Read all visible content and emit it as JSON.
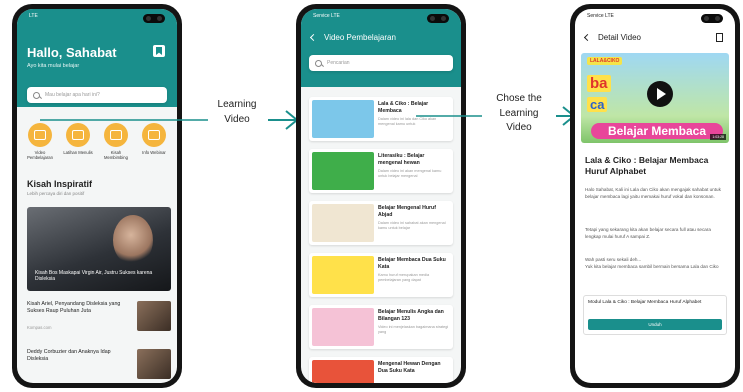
{
  "arrows": {
    "first_label": [
      "Learning",
      "Video"
    ],
    "second_label": [
      "Chose the",
      "Learning",
      "Video"
    ]
  },
  "home": {
    "status": "LTE",
    "greeting": "Hallo, Sahabat",
    "subtitle": "Ayo kita mulai belajar",
    "search_placeholder": "Mau belajar apa hari ini?",
    "categories": [
      {
        "label": "Video Pembelajaran",
        "icon": "play-icon"
      },
      {
        "label": "Latihan Menulis",
        "icon": "letter-icon"
      },
      {
        "label": "Kisah Membimbing",
        "icon": "people-icon"
      },
      {
        "label": "Info Webinar",
        "icon": "screen-icon"
      }
    ],
    "section_title": "Kisah Inspiratif",
    "section_subtitle": "Lebih percaya diri dan positif",
    "hero_caption": "Kisah Bos Maskapai Virgin Air, Justru Sukses karena Disleksia",
    "news": [
      {
        "title": "Kisah Ariel, Penyandang Disleksia yang Sukses Raup Puluhan Juta",
        "source": "Kompas.com"
      },
      {
        "title": "Deddy Corbuzier dan Anaknya Idap Disleksia",
        "source": ""
      }
    ]
  },
  "video_list": {
    "status": "Service LTE",
    "title": "Video Pembelajaran",
    "search_placeholder": "Pencarian",
    "items": [
      {
        "title": "Lala & Ciko : Belajar Membaca",
        "desc": "Dalam video ini lala dan Ciko akan mengenal kamu untuk",
        "thumb_color": "#7cc7ea"
      },
      {
        "title": "Literasiku : Belajar mengenal hewan",
        "desc": "Dalam video ini akan mengenal kamu untuk belajar mengenal",
        "thumb_color": "#3fae4a"
      },
      {
        "title": "Belajar Mengenal Huruf Abjad",
        "desc": "Dalam video ini sahabat akan mengenal kamu untuk belajar",
        "thumb_color": "#f0e6d2"
      },
      {
        "title": "Belajar Membaca Dua Suku Kata",
        "desc": "Kamu huruf merupakan media pembelajaran yang dapat",
        "thumb_color": "#ffe14a"
      },
      {
        "title": "Belajar Menulis Angka dan Bilangan 123",
        "desc": "Video ini menjelaskan bagaimana strategi yang",
        "thumb_color": "#f5c2d6"
      },
      {
        "title": "Mengenal Hewan Dengan Dua Suku Kata",
        "desc": "",
        "thumb_color": "#e8533a"
      }
    ]
  },
  "detail": {
    "status": "Service LTE",
    "title": "Detail Video",
    "video": {
      "logo": "LALA&CIKO",
      "line1": "ba",
      "line2": "ca",
      "banner": "Belajar Membaca",
      "duration": "1:03:28"
    },
    "video_title": "Lala & Ciko : Belajar  Membaca Huruf Alphabet",
    "paragraphs": [
      "Halo Sahabat, Kali ini Lala dan Ciko akan mengajak sahabat untuk belajar membaca lagi yaitu memakai huruf vokal dan konsonan.",
      "Tetapi  yang sekarang kita akan belajar secara full atau secara lengkap mulai huruf A sampai Z.",
      "Wah pasti seru sekali deh...\nYuk kita belajar membaca sambil bermain bersama Lala dan Ciko"
    ],
    "module_title": "Modul Lala & Ciko : Belajar Membaca Huruf Alphabet",
    "download_label": "Unduh"
  },
  "colors": {
    "primary": "#1a8f8c",
    "accent": "#f5b53d"
  }
}
